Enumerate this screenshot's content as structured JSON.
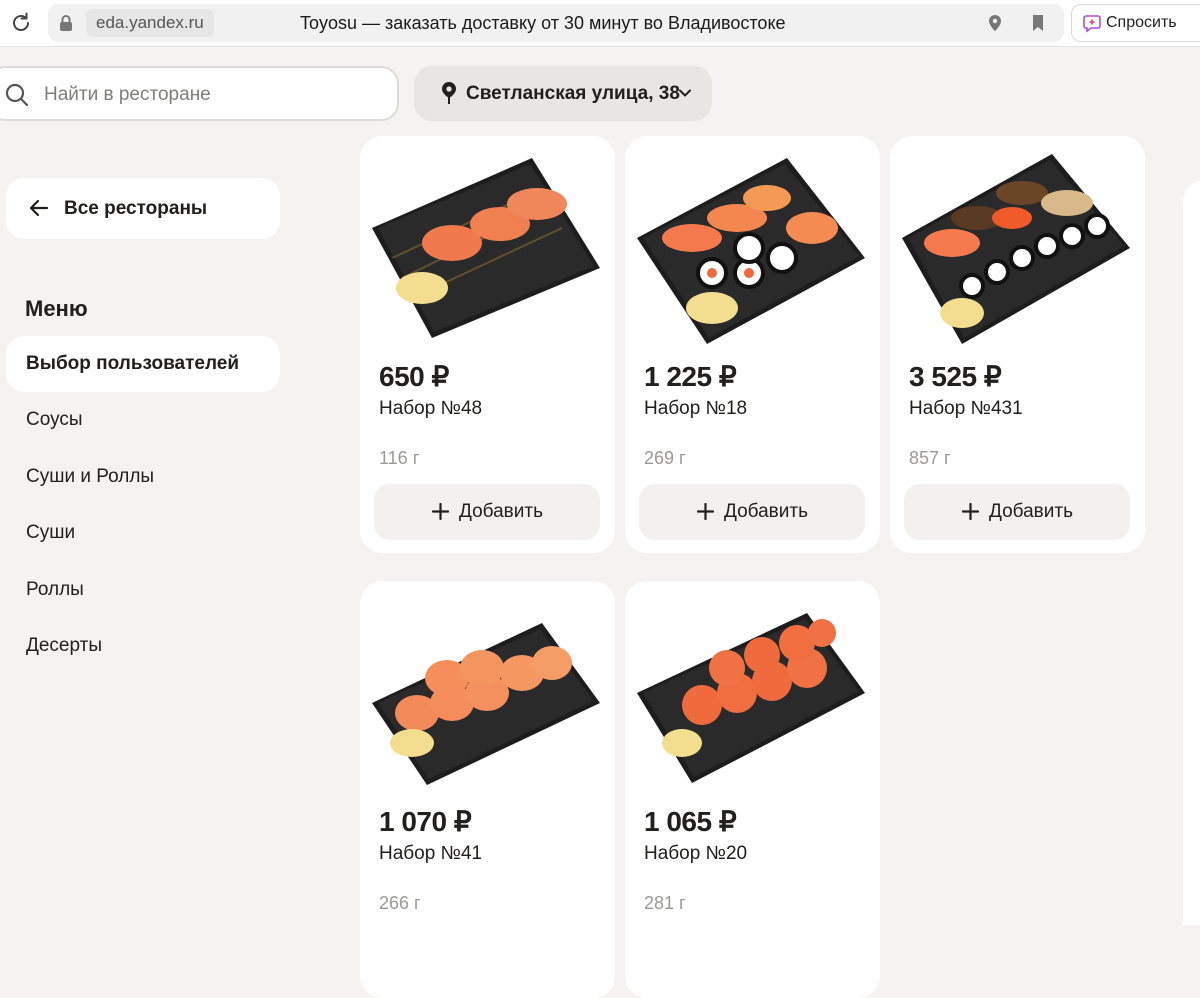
{
  "browser": {
    "domain": "eda.yandex.ru",
    "page_title": "Toyosu — заказать доставку от 30 минут во Владивостоке",
    "ask_button": "Спросить"
  },
  "header": {
    "search_placeholder": "Найти в ресторане",
    "address": "Светланская улица, 38"
  },
  "sidebar": {
    "back_label": "Все рестораны",
    "menu_title": "Меню",
    "items": [
      {
        "label": "Выбор пользователей",
        "active": true
      },
      {
        "label": "Соусы"
      },
      {
        "label": "Суши и Роллы"
      },
      {
        "label": "Суши"
      },
      {
        "label": "Роллы"
      },
      {
        "label": "Десерты"
      }
    ]
  },
  "products": [
    {
      "price": "650 ₽",
      "name": "Набор №48",
      "weight": "116 г",
      "add_label": "Добавить"
    },
    {
      "price": "1 225 ₽",
      "name": "Набор №18",
      "weight": "269 г",
      "add_label": "Добавить"
    },
    {
      "price": "3 525 ₽",
      "name": "Набор №431",
      "weight": "857 г",
      "add_label": "Добавить"
    },
    {
      "price": "1 070 ₽",
      "name": "Набор №41",
      "weight": "266 г"
    },
    {
      "price": "1 065 ₽",
      "name": "Набор №20",
      "weight": "281 г"
    }
  ]
}
